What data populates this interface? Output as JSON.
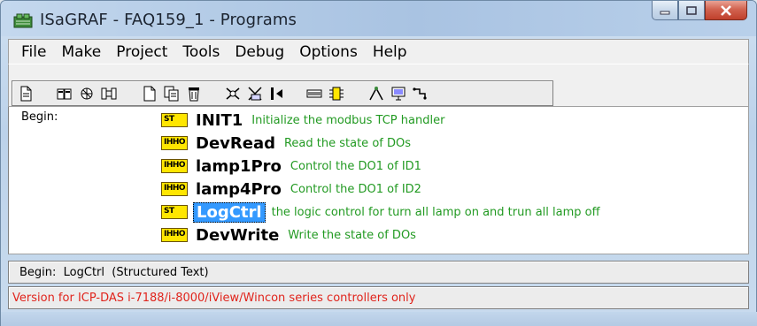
{
  "window": {
    "title": "ISaGRAF - FAQ159_1 - Programs"
  },
  "menu": [
    "File",
    "Make",
    "Project",
    "Tools",
    "Debug",
    "Options",
    "Help"
  ],
  "toolbar": {
    "icons": [
      "new-page-icon",
      "dictionary-icon",
      "link-icon",
      "io-connection-icon",
      "new-program-icon",
      "copy-program-icon",
      "delete-icon",
      "compile-icon",
      "verify-icon",
      "run-icon",
      "io-board-icon",
      "sim-icon",
      "debug-icon",
      "monitor-icon",
      "connect-icon"
    ]
  },
  "list": {
    "section_label": "Begin:",
    "programs": [
      {
        "icon": "structured-text-icon",
        "icon_text": "ST",
        "name": "INIT1",
        "description": "Initialize the modbus TCP handler",
        "selected": false
      },
      {
        "icon": "ladder-diagram-icon",
        "icon_text": "IHHO",
        "name": "DevRead",
        "description": "Read the state of DOs",
        "selected": false
      },
      {
        "icon": "ladder-diagram-icon",
        "icon_text": "IHHO",
        "name": "lamp1Pro",
        "description": "Control the DO1 of ID1",
        "selected": false
      },
      {
        "icon": "ladder-diagram-icon",
        "icon_text": "IHHO",
        "name": "lamp4Pro",
        "description": "Control the DO1 of ID2",
        "selected": false
      },
      {
        "icon": "structured-text-icon",
        "icon_text": "ST",
        "name": "LogCtrl",
        "description": "the logic control for turn all lamp on and trun all lamp off",
        "selected": true
      },
      {
        "icon": "ladder-diagram-icon",
        "icon_text": "IHHO",
        "name": "DevWrite",
        "description": "Write the state of DOs",
        "selected": false
      }
    ]
  },
  "status": {
    "info": "Begin:  LogCtrl  (Structured Text)",
    "version_note": "Version for ICP-DAS i-7188/i-8000/iView/Wincon series controllers only"
  },
  "colors": {
    "description_green": "#229a22",
    "selection_blue": "#3399ff",
    "version_red": "#e0241c",
    "program_icon_yellow": "#ffe600"
  }
}
